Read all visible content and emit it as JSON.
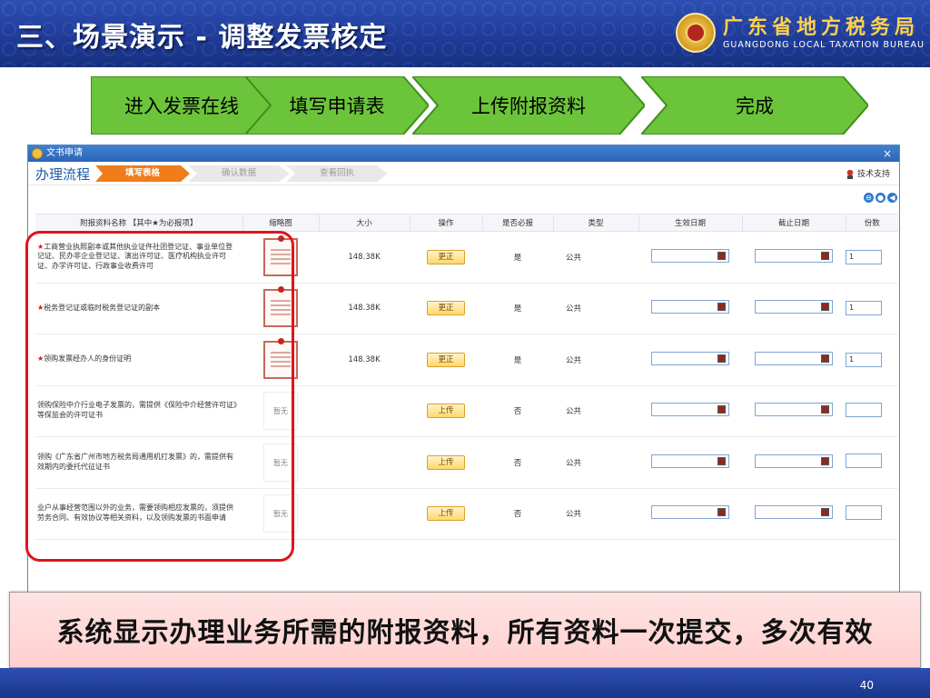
{
  "slide": {
    "title": "三、场景演示 - 调整发票核定",
    "bureau_cn": "广东省地方税务局",
    "bureau_en": "GUANGDONG LOCAL TAXATION BUREAU",
    "page_number": "40"
  },
  "steps": [
    {
      "label": "进入发票在线"
    },
    {
      "label": "填写申请表"
    },
    {
      "label": "上传附报资料"
    },
    {
      "label": "完成"
    }
  ],
  "colors": {
    "step_green": "#6cc43a",
    "window_blue": "#2c66b6",
    "highlight_red": "#e0141c",
    "banner_pink": "#ffd6d6",
    "active_flow_orange": "#f07c1a"
  },
  "window": {
    "title": "文书申请",
    "close_label": "×",
    "flow_label": "办理流程",
    "flow_steps": [
      {
        "label": "填写表格",
        "active": true
      },
      {
        "label": "确认数据",
        "active": false
      },
      {
        "label": "查看回执",
        "active": false
      }
    ],
    "tech_support": "技术支持",
    "tool_icons": [
      "expand-icon",
      "refresh-icon",
      "back-icon"
    ]
  },
  "table": {
    "headers": {
      "name": "附报资料名称 【其中★为必报项】",
      "thumb": "缩略图",
      "size": "大小",
      "action": "操作",
      "required": "是否必报",
      "type": "类型",
      "start": "生效日期",
      "end": "截止日期",
      "count": "份数"
    },
    "rows": [
      {
        "star": "★",
        "name": "工商营业执照副本或其他执业证件社团登记证、事业单位登记证、民办非企业登记证、演出许可证、医疗机构执业许可证、办学许可证、行政事业收费许可",
        "thumb": "cert",
        "size": "148.38K",
        "action": "更正",
        "required": "是",
        "type": "公共",
        "count": "1"
      },
      {
        "star": "★",
        "name": "税务登记证或临时税务登记证的副本",
        "thumb": "cert",
        "size": "148.38K",
        "action": "更正",
        "required": "是",
        "type": "公共",
        "count": "1"
      },
      {
        "star": "★",
        "name": "领购发票经办人的身份证明",
        "thumb": "cert",
        "size": "148.38K",
        "action": "更正",
        "required": "是",
        "type": "公共",
        "count": "1"
      },
      {
        "star": "",
        "name": "领购保险中介行业电子发票的，需提供《保险中介经营许可证》等保监会的许可证书",
        "thumb": "暂无",
        "size": "",
        "action": "上传",
        "required": "否",
        "type": "公共",
        "count": ""
      },
      {
        "star": "",
        "name": "领购《广东省广州市地方税务局通用机打发票》的，需提供有效期内的委托代征证书",
        "thumb": "暂无",
        "size": "",
        "action": "上传",
        "required": "否",
        "type": "公共",
        "count": ""
      },
      {
        "star": "",
        "name": "业户从事经营范围以外的业务，需要领购相应发票的，须提供劳务合同、有效协议等相关资料，以及领购发票的书面申请",
        "thumb": "暂无",
        "size": "",
        "action": "上传",
        "required": "否",
        "type": "公共",
        "count": ""
      }
    ]
  },
  "banner": {
    "text": "系统显示办理业务所需的附报资料，所有资料一次提交，多次有效"
  }
}
